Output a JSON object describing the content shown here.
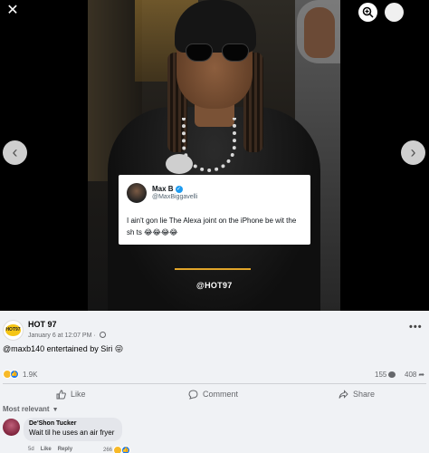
{
  "viewer": {
    "close_glyph": "✕",
    "prev_glyph": "‹",
    "next_glyph": "›",
    "zoom_glyph": "⊕"
  },
  "tweet": {
    "name": "Max B",
    "handle": "@MaxBiggavelli",
    "text": "I ain't gon lie The Alexa joint on the iPhone be wit the sh ts 😂😂😂😂"
  },
  "watermark": "@HOT97",
  "post": {
    "page_name": "HOT 97",
    "date": "January 6 at 12:07 PM · ",
    "caption": "@maxb140 entertained by Siri 😜",
    "reaction_count": "1.9K",
    "comment_count": "155",
    "share_count": "408",
    "more_glyph": "•••",
    "avatar_text": "HOT97"
  },
  "actions": {
    "like": "Like",
    "comment": "Comment",
    "share": "Share"
  },
  "comments": {
    "sort_label": "Most relevant",
    "items": [
      {
        "author": "De'Shon Tucker",
        "text": "Wait til he uses an air fryer",
        "age": "5d",
        "like": "Like",
        "reply": "Reply",
        "reaction_count": "266"
      }
    ]
  },
  "colors": {
    "accent_blue": "#1877f2",
    "haha_yellow": "#f7b928",
    "tweet_line": "#e1a52a",
    "panel_bg": "#f0f2f5"
  }
}
